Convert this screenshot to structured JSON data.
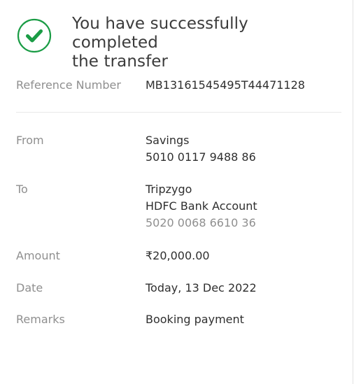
{
  "header": {
    "status_icon": "check-circle-icon",
    "status_color": "#1a9c45",
    "message_line1": "You have successfully completed",
    "message_line2": "the transfer"
  },
  "details": {
    "reference": {
      "label": "Reference Number",
      "value": "MB13161545495T44471128"
    },
    "from": {
      "label": "From",
      "account_type": "Savings",
      "account_number": "5010 0117 9488 86"
    },
    "to": {
      "label": "To",
      "payee_name": "Tripzygo",
      "bank_account": "HDFC Bank Account",
      "account_number": "5020 0068 6610 36"
    },
    "amount": {
      "label": "Amount",
      "value": "₹20,000.00"
    },
    "date": {
      "label": "Date",
      "value": "Today, 13 Dec 2022"
    },
    "remarks": {
      "label": "Remarks",
      "value": "Booking payment"
    }
  }
}
